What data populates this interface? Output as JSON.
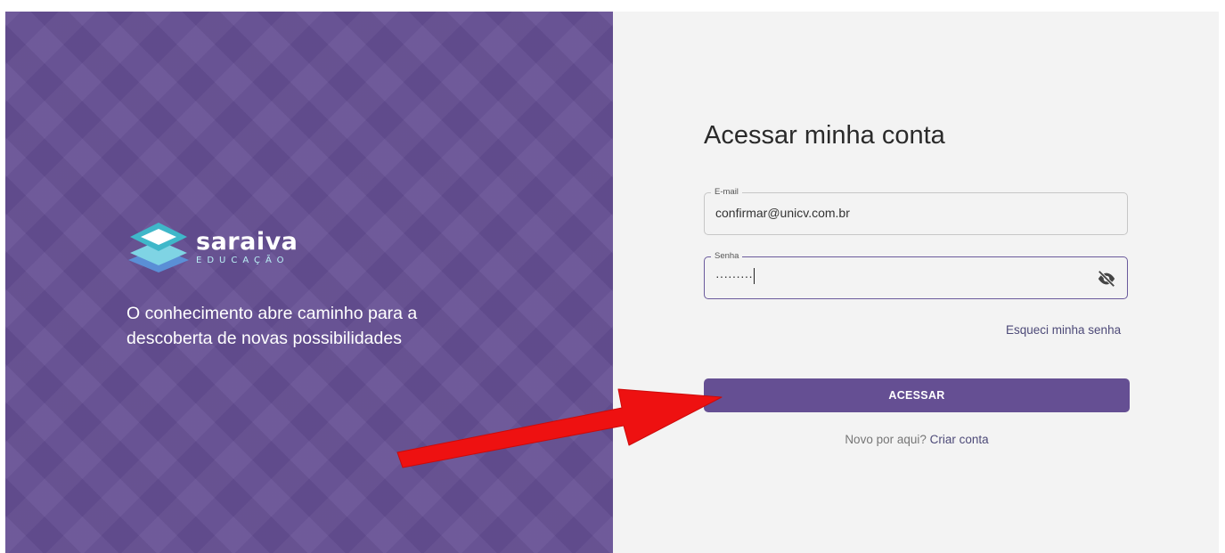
{
  "brand": {
    "name": "saraiva",
    "subtitle": "EDUCAÇÃO",
    "tagline": "O conhecimento abre caminho para a descoberta de novas possibilidades"
  },
  "login": {
    "title": "Acessar minha conta",
    "email": {
      "label": "E-mail",
      "value": "confirmar@unicv.com.br"
    },
    "password": {
      "label": "Senha",
      "masked_value": "·········",
      "toggle_icon": "eye-off-icon"
    },
    "forgot_password": "Esqueci minha senha",
    "submit_label": "ACESSAR",
    "signup_prompt": "Novo por aqui?",
    "signup_link": "Criar conta"
  },
  "colors": {
    "brand_purple": "#654f93",
    "link": "#4d4a78",
    "panel_bg": "#f3f3f3",
    "annotation_arrow": "#ee1111"
  }
}
